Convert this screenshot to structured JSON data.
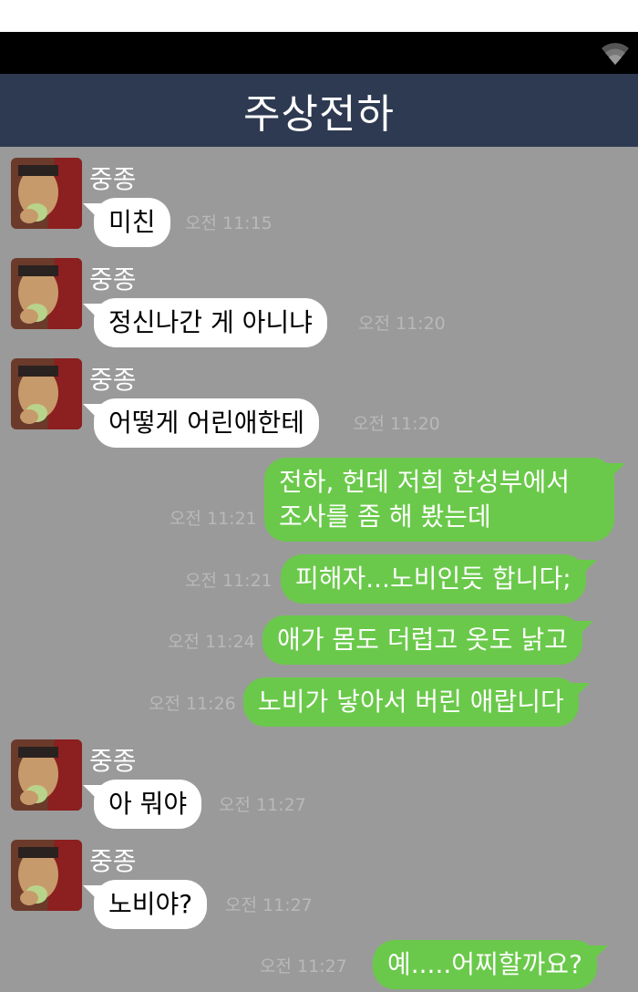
{
  "header": {
    "title": "주상전하"
  },
  "status": {
    "wifi_icon": "wifi-icon"
  },
  "colors": {
    "title_bar": "#2e3a51",
    "chat_bg": "#9a9a9a",
    "out_bubble": "#6ac94a",
    "in_bubble": "#ffffff"
  },
  "messages": [
    {
      "sender": "중종",
      "text": "미친",
      "time": "오전 11:15"
    },
    {
      "sender": "중종",
      "text": "정신나간 게 아니냐",
      "time": "오전 11:20"
    },
    {
      "sender": "중종",
      "text": "어떻게 어린애한테",
      "time": "오전 11:20"
    },
    {
      "text": "전하, 헌데 저희 한성부에서 조사를 좀 해 봤는데",
      "time": "오전 11:21"
    },
    {
      "text": "피해자...노비인듯 합니다;",
      "time": "오전 11:21"
    },
    {
      "text": "애가 몸도 더럽고 옷도 낡고",
      "time": "오전 11:24"
    },
    {
      "text": "노비가 낳아서 버린 애랍니다",
      "time": "오전 11:26"
    },
    {
      "sender": "중종",
      "text": "아 뭐야",
      "time": "오전 11:27"
    },
    {
      "sender": "중종",
      "text": "노비야?",
      "time": "오전 11:27"
    },
    {
      "text": "예.....어찌할까요?",
      "time": "오전 11:27"
    }
  ]
}
